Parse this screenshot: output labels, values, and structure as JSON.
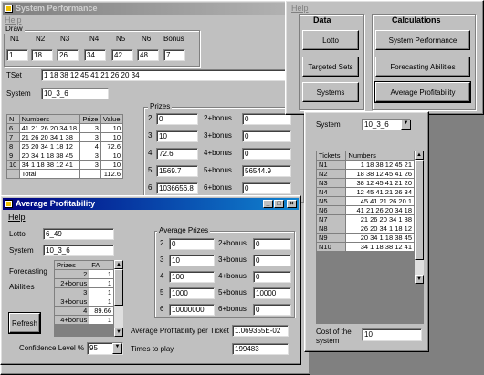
{
  "colors": {
    "desktop": "#808080",
    "window": "#c0c0c0",
    "title_active": "#000080",
    "title_inactive": "#808080"
  },
  "main_window": {
    "title": "System Performance",
    "menu": {
      "help": "Help"
    },
    "draw": {
      "group_label": "Draw",
      "headers": [
        "N1",
        "N2",
        "N3",
        "N4",
        "N5",
        "N6",
        "Bonus"
      ],
      "values": [
        "1",
        "18",
        "26",
        "34",
        "42",
        "48",
        "7"
      ]
    },
    "tset_label": "TSet",
    "tset_value": "1 18 38 12 45 41 21 26 20 34",
    "system_label": "System",
    "system_value": "10_3_6",
    "results_table": {
      "headers": [
        "N",
        "Numbers",
        "Prize",
        "Value"
      ],
      "rows": [
        [
          "6",
          "41 21 26 20 34 18",
          "3",
          "10"
        ],
        [
          "7",
          "21 26 20 34 1 38",
          "3",
          "10"
        ],
        [
          "8",
          "26 20 34 1 18 12",
          "4",
          "72.6"
        ],
        [
          "9",
          "20 34 1 18 38 45",
          "3",
          "10"
        ],
        [
          "10",
          "34 1 18 38 12 41",
          "3",
          "10"
        ],
        [
          "",
          "Total",
          "",
          "112.6"
        ]
      ]
    },
    "prizes": {
      "group_label": "Prizes",
      "rows": [
        {
          "n": "2",
          "value": "0",
          "bonus_label": "2+bonus",
          "bonus_value": "0"
        },
        {
          "n": "3",
          "value": "10",
          "bonus_label": "3+bonus",
          "bonus_value": "0"
        },
        {
          "n": "4",
          "value": "72.6",
          "bonus_label": "4+bonus",
          "bonus_value": "0"
        },
        {
          "n": "5",
          "value": "1569.7",
          "bonus_label": "5+bonus",
          "bonus_value": "56544.9"
        },
        {
          "n": "6",
          "value": "1036656.8",
          "bonus_label": "6+bonus",
          "bonus_value": "0"
        }
      ]
    }
  },
  "menu_window": {
    "help": "Help",
    "data_label": "Data",
    "calc_label": "Calculations",
    "buttons": {
      "lotto": "Lotto",
      "targeted_sets": "Targeted Sets",
      "systems": "Systems",
      "system_performance": "System Performance",
      "forecasting_abilities": "Forecasting Abilities",
      "average_profitability": "Average Profitability"
    }
  },
  "system_panel": {
    "system_label": "System",
    "system_value": "10_3_6",
    "tickets_headers": [
      "Tickets",
      "Numbers"
    ],
    "tickets": [
      [
        "N1",
        "1 18 38 12 45 21"
      ],
      [
        "N2",
        "18 38 12 45 41 26"
      ],
      [
        "N3",
        "38 12 45 41 21 20"
      ],
      [
        "N4",
        "12 45 41 21 26 34"
      ],
      [
        "N5",
        "45 41 21 26 20 1"
      ],
      [
        "N6",
        "41 21 26 20 34 18"
      ],
      [
        "N7",
        "21 26 20 34 1 38"
      ],
      [
        "N8",
        "26 20 34 1 18 12"
      ],
      [
        "N9",
        "20 34 1 18 38 45"
      ],
      [
        "N10",
        "34 1 18 38 12 41"
      ]
    ],
    "cost_label": "Cost of the system",
    "cost_value": "10"
  },
  "avg_window": {
    "title": "Average Profitability",
    "menu": {
      "help": "Help"
    },
    "lotto_label": "Lotto",
    "lotto_value": "6_49",
    "system_label": "System",
    "system_value": "10_3_6",
    "forecasting_label": "Forecasting",
    "abilities_label": "Abilities",
    "fa_table": {
      "headers": [
        "Prizes",
        "FA"
      ],
      "rows": [
        [
          "2",
          "1"
        ],
        [
          "2+bonus",
          "1"
        ],
        [
          "3",
          "1"
        ],
        [
          "3+bonus",
          "1"
        ],
        [
          "4",
          "89.66"
        ],
        [
          "4+bonus",
          "1"
        ]
      ]
    },
    "refresh_label": "Refresh",
    "avg_prizes": {
      "group_label": "Average Prizes",
      "rows": [
        {
          "n": "2",
          "value": "0",
          "bonus_label": "2+bonus",
          "bonus_value": "0"
        },
        {
          "n": "3",
          "value": "10",
          "bonus_label": "3+bonus",
          "bonus_value": "0"
        },
        {
          "n": "4",
          "value": "100",
          "bonus_label": "4+bonus",
          "bonus_value": "0"
        },
        {
          "n": "5",
          "value": "1000",
          "bonus_label": "5+bonus",
          "bonus_value": "10000"
        },
        {
          "n": "6",
          "value": "10000000",
          "bonus_label": "6+bonus",
          "bonus_value": "0"
        }
      ]
    },
    "avg_profit_label": "Average Profitability per Ticket",
    "avg_profit_value": "1.069355E-02",
    "times_label": "Times to play",
    "times_value": "199483",
    "confidence_label": "Confidence Level %",
    "confidence_value": "95"
  }
}
